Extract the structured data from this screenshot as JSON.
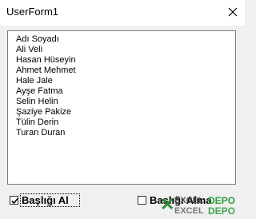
{
  "window": {
    "title": "UserForm1",
    "close_icon": "close-icon"
  },
  "listbox": {
    "items": [
      "Adı Soyadı",
      "Ali Veli",
      "Hasan Hüseyin",
      "Ahmet Mehmet",
      "Hale Jale",
      "Ayşe Fatma",
      "Selin Helin",
      "Şaziye Pakize",
      "Tülin Derin",
      "Turan Duran"
    ]
  },
  "checkboxes": [
    {
      "label": "Başlığı Al",
      "checked": true
    },
    {
      "label": "Başlığı Alma",
      "checked": false
    }
  ],
  "watermark": {
    "line1_left": "EXCEL",
    "line1_right": "DEPO",
    "line2_left": "EXCEL",
    "line2_right": "DEPO"
  },
  "colors": {
    "window_bg": "#f0f0f0",
    "titlebar_bg": "#ffffff",
    "list_border": "#7a7a7a",
    "watermark_green": "#2f9e3f"
  }
}
